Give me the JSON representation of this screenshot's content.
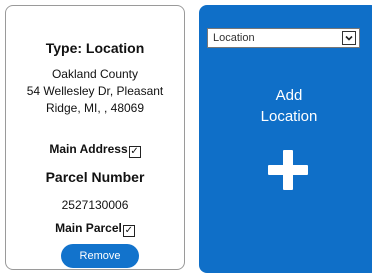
{
  "location_card": {
    "title": "Type: Location",
    "address_lines": [
      "Oakland County",
      "54 Wellesley Dr, Pleasant",
      "Ridge, MI, , 48069"
    ],
    "main_address_label": "Main Address",
    "main_address_checked": true,
    "parcel_title": "Parcel Number",
    "parcel_number": "2527130006",
    "main_parcel_label": "Main Parcel",
    "main_parcel_checked": true,
    "remove_label": "Remove"
  },
  "add_card": {
    "select_value": "Location",
    "add_label_line1": "Add",
    "add_label_line2": "Location",
    "plus_icon": "plus-icon",
    "background_color": "#0f6fc8"
  },
  "colors": {
    "accent": "#1273cc"
  }
}
